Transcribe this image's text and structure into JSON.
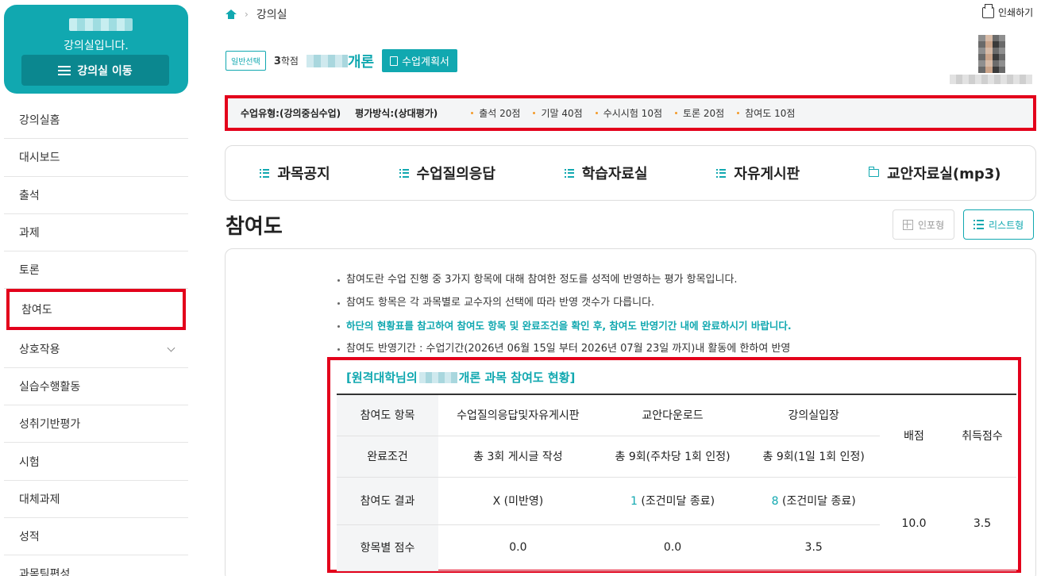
{
  "sidebar": {
    "title": "강의실입니다.",
    "room_button": "강의실 이동",
    "items": [
      {
        "label": "강의실홈"
      },
      {
        "label": "대시보드"
      },
      {
        "label": "출석"
      },
      {
        "label": "과제"
      },
      {
        "label": "토론"
      },
      {
        "label": "참여도",
        "active": true
      },
      {
        "label": "상호작용",
        "expandable": true
      },
      {
        "label": "실습수행활동"
      },
      {
        "label": "성취기반평가"
      },
      {
        "label": "시험"
      },
      {
        "label": "대체과제"
      },
      {
        "label": "성적"
      },
      {
        "label": "과목팀편성"
      }
    ]
  },
  "breadcrumb": {
    "current": "강의실"
  },
  "print_label": "인쇄하기",
  "course": {
    "tag": "일반선택",
    "credits_num": "3",
    "credits_unit": "학점",
    "name_suffix": "개론",
    "plan_button": "수업계획서"
  },
  "info_bar": {
    "type": "수업유형:(강의중심수업)",
    "eval": "평가방식:(상대평가)",
    "scores": [
      "출석 20점",
      "기말 40점",
      "수시시험 10점",
      "토론 20점",
      "참여도 10점"
    ]
  },
  "boards": [
    {
      "label": "과목공지",
      "icon": "list-icon"
    },
    {
      "label": "수업질의응답",
      "icon": "list-icon"
    },
    {
      "label": "학습자료실",
      "icon": "list-icon"
    },
    {
      "label": "자유게시판",
      "icon": "list-icon"
    },
    {
      "label": "교안자료실(mp3)",
      "icon": "folder-icon"
    }
  ],
  "page_title": "참여도",
  "view": {
    "card": "인포형",
    "list": "리스트형"
  },
  "notes": [
    "참여도란 수업 진행 중 3가지 항목에 대해 참여한 정도를 성적에 반영하는 평가 항목입니다.",
    "참여도 항목은 각 과목별로 교수자의 선택에 따라 반영 갯수가 다릅니다.",
    "하단의 현황표를 참고하여 참여도 항목 및 완료조건을 확인 후, 참여도 반영기간 내에 완료하시기 바랍니다.",
    "참여도 반영기간 : 수업기간(2026년 06월 15일 부터 2026년 07월 23일 까지)내 활동에 한하여 반영"
  ],
  "status": {
    "title_prefix": "[원격대학님의",
    "title_suffix": "개론 과목 참여도 현황]",
    "table": {
      "row_item": "참여도 항목",
      "row_cond": "완료조건",
      "row_result": "참여도 결과",
      "row_score": "항목별 점수",
      "col_qa": "수업질의응답및자유게시판",
      "col_dl": "교안다운로드",
      "col_enter": "강의실입장",
      "col_alloc": "배점",
      "col_earned": "취득점수",
      "cond_qa": "총 3회 게시글 작성",
      "cond_dl": "총 9회(주차당 1회 인정)",
      "cond_enter": "총 9회(1일 1회 인정)",
      "result_qa": "X (미반영)",
      "result_dl_num": "1",
      "result_dl_text": " (조건미달 종료)",
      "result_enter_num": "8",
      "result_enter_text": " (조건미달 종료)",
      "score_qa": "0.0",
      "score_dl": "0.0",
      "score_enter": "3.5",
      "alloc": "10.0",
      "earned": "3.5"
    }
  },
  "colors": {
    "accent": "#11a8b0",
    "highlight": "#e3001b",
    "bullet": "#f39b2b"
  }
}
